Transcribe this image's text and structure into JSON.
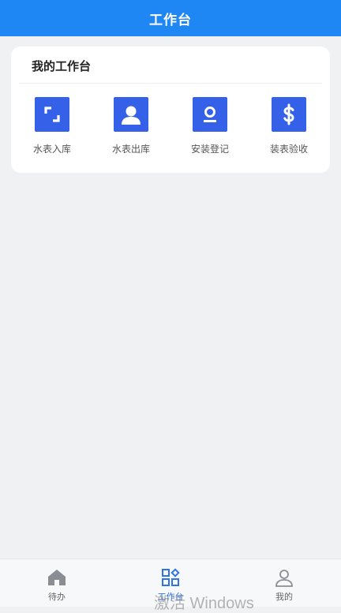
{
  "header": {
    "title": "工作台"
  },
  "workbench": {
    "title": "我的工作台",
    "items": [
      {
        "label": "水表入库",
        "icon": "scan-frame-icon"
      },
      {
        "label": "水表出库",
        "icon": "user-icon"
      },
      {
        "label": "安装登记",
        "icon": "id-badge-icon"
      },
      {
        "label": "装表验收",
        "icon": "dollar-icon"
      }
    ],
    "icon_color": "#3461e8"
  },
  "tabbar": {
    "tabs": [
      {
        "label": "待办",
        "icon": "home-icon",
        "active": false
      },
      {
        "label": "工作台",
        "icon": "grid-icon",
        "active": true
      },
      {
        "label": "我的",
        "icon": "person-icon",
        "active": false
      }
    ],
    "active_color": "#2e74e6"
  },
  "watermark": {
    "text": "激活 Windows"
  },
  "colors": {
    "header_bg": "#1f87f4",
    "page_bg": "#f0f1f3"
  }
}
